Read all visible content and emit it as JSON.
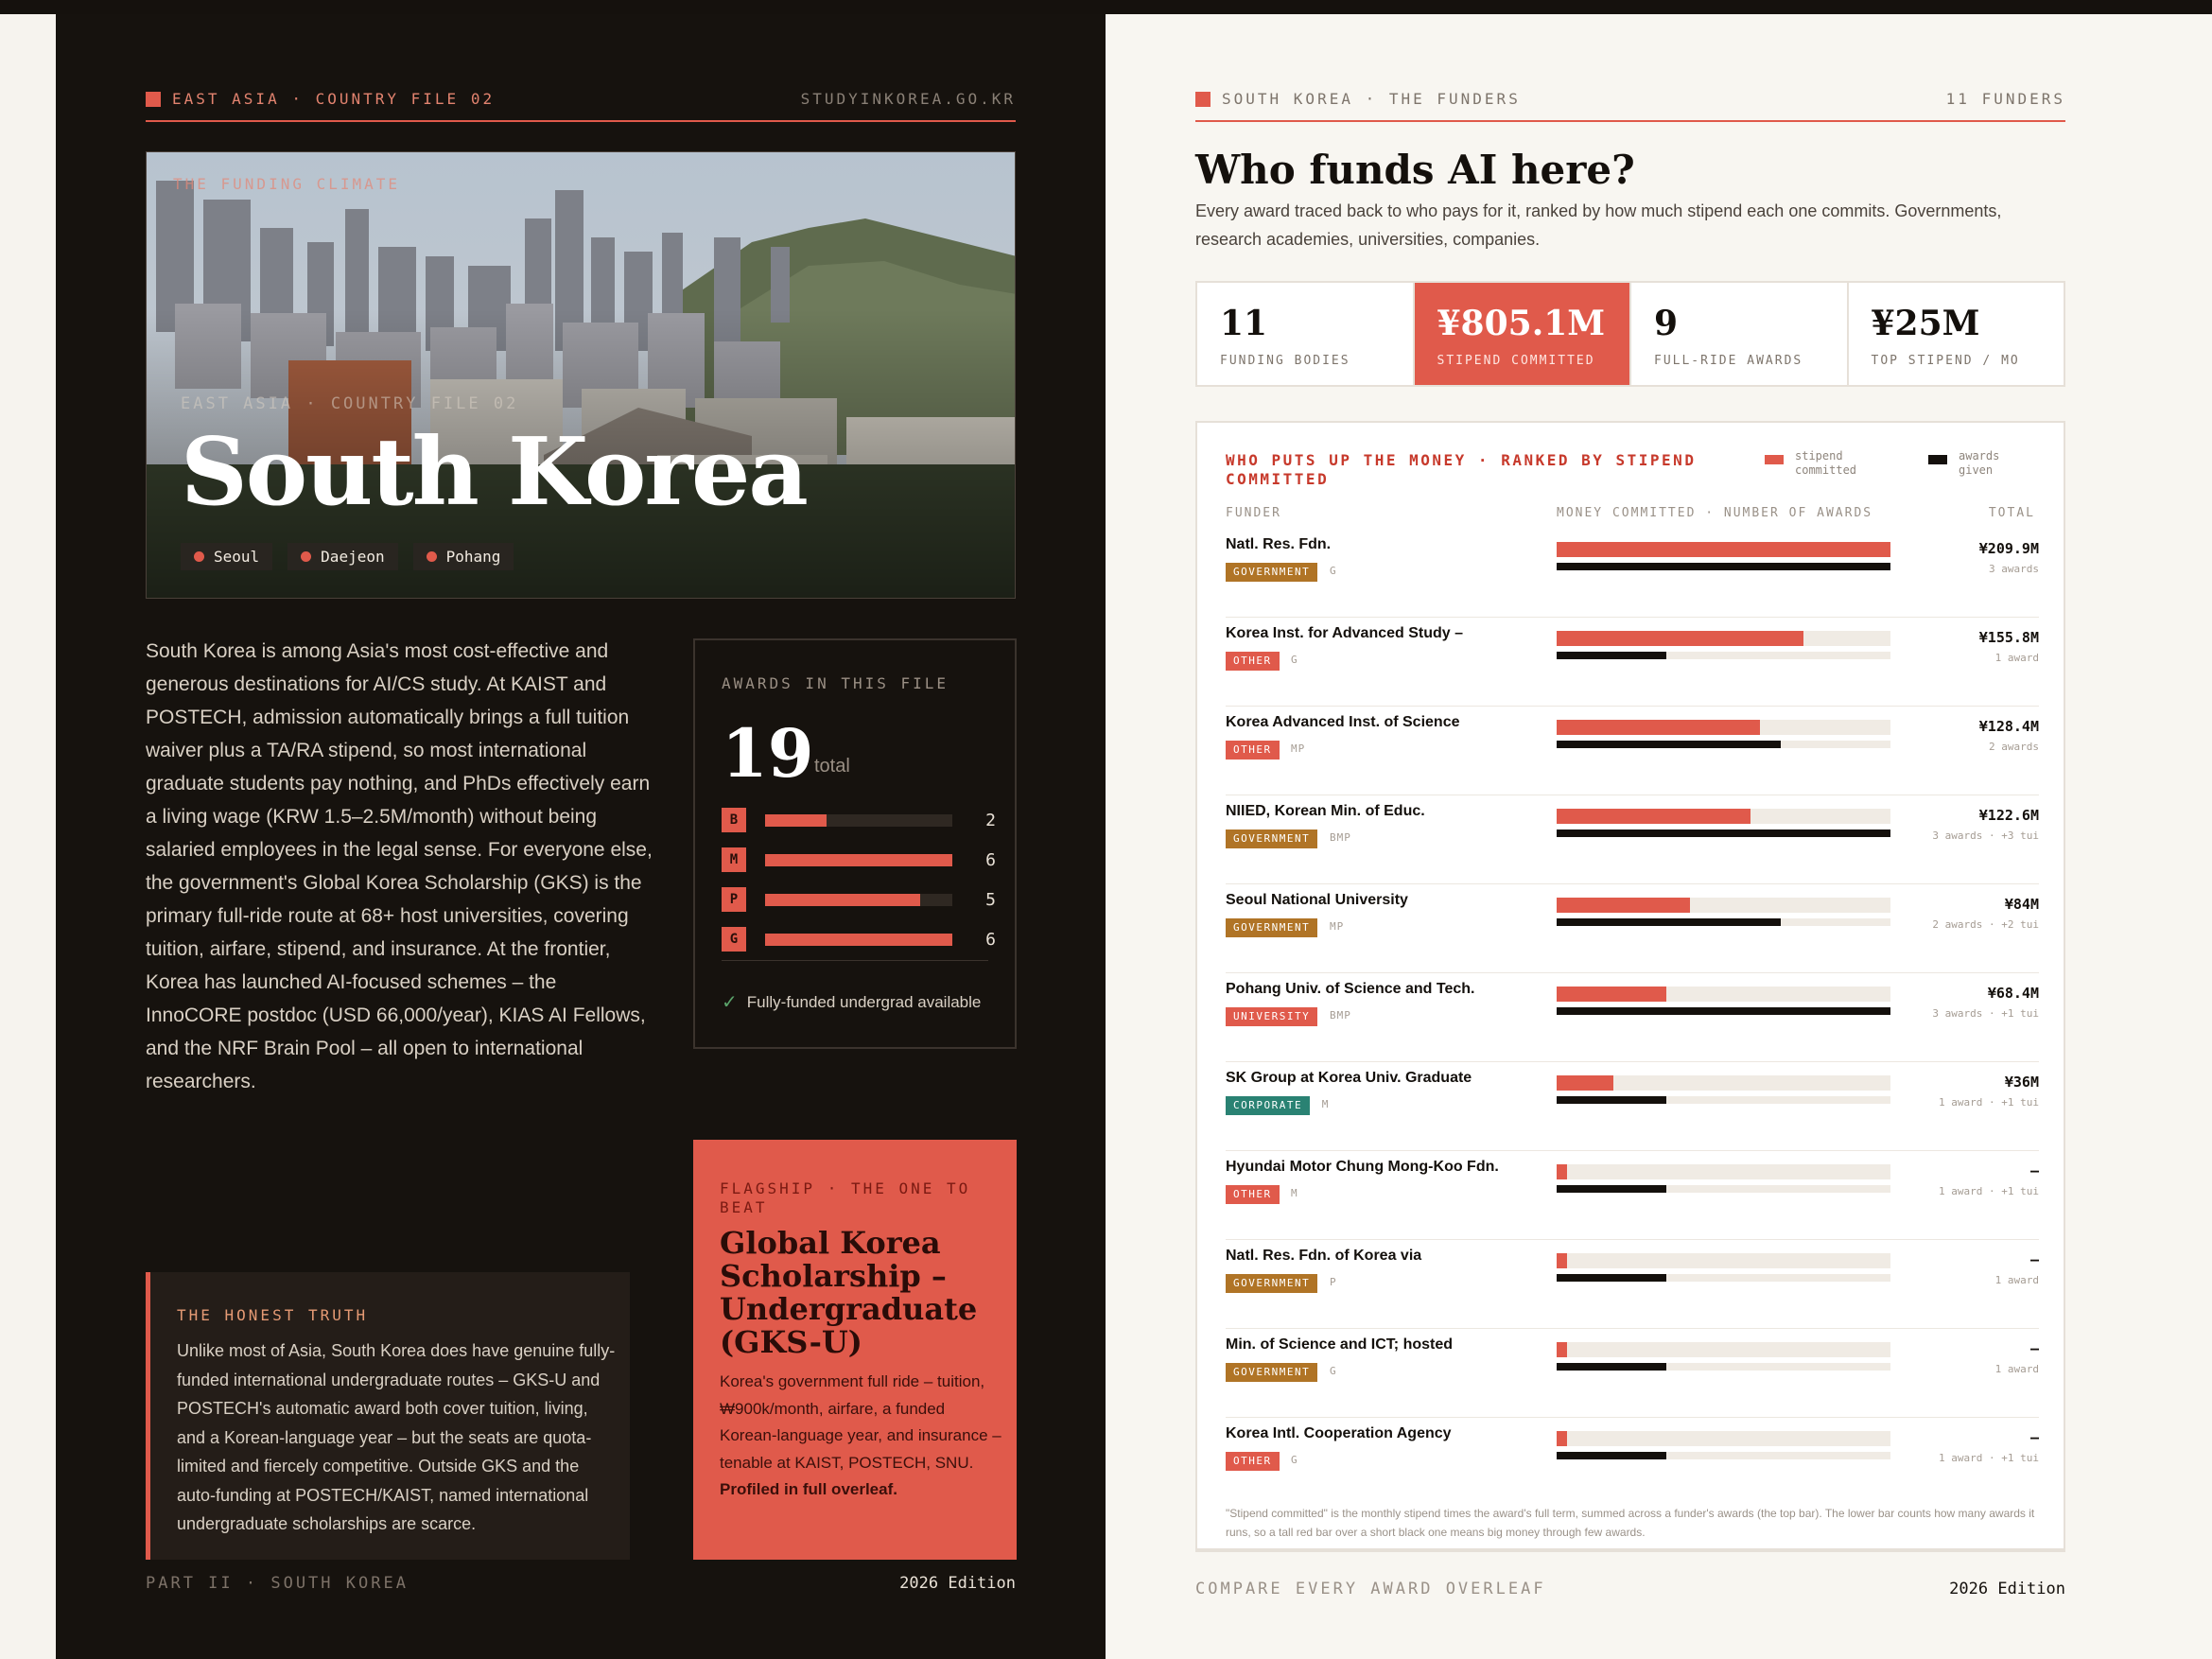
{
  "left": {
    "header": {
      "section": "EAST ASIA · COUNTRY FILE 02",
      "site": "STUDYINKOREA.GO.KR"
    },
    "hero": {
      "kicker": "THE FUNDING CLIMATE",
      "sub": "EAST ASIA · COUNTRY FILE 02",
      "title": "South Korea",
      "cities": [
        "Seoul",
        "Daejeon",
        "Pohang"
      ]
    },
    "intro": "South Korea is among Asia's most cost-effective and generous destinations for AI/CS study. At KAIST and POSTECH, admission automatically brings a full tuition waiver plus a TA/RA stipend, so most international graduate students pay nothing, and PhDs effectively earn a living wage (KRW 1.5–2.5M/month) without being salaried employees in the legal sense. For everyone else, the government's Global Korea Scholarship (GKS) is the primary full-ride route at 68+ host universities, covering tuition, airfare, stipend, and insurance. At the frontier, Korea has launched AI-focused schemes – the InnoCORE postdoc (USD 66,000/year), KIAS AI Fellows, and the NRF Brain Pool – all open to international researchers.",
    "awards": {
      "label": "AWARDS IN THIS FILE",
      "total": "19",
      "total_label": "total",
      "levels": [
        {
          "code": "B",
          "count": 2
        },
        {
          "code": "M",
          "count": 6
        },
        {
          "code": "P",
          "count": 5
        },
        {
          "code": "G",
          "count": 6
        }
      ],
      "level_fill_fractions": [
        0.33,
        1.0,
        0.83,
        1.0
      ],
      "footnote": "Fully-funded undergrad available"
    },
    "truth": {
      "kicker": "THE HONEST TRUTH",
      "text": "Unlike most of Asia, South Korea does have genuine fully-funded international undergraduate routes – GKS-U and POSTECH's automatic award both cover tuition, living, and a Korean-language year – but the seats are quota-limited and fiercely competitive. Outside GKS and the auto-funding at POSTECH/KAIST, named international undergraduate scholarships are scarce."
    },
    "flagship": {
      "kicker": "FLAGSHIP · THE ONE TO BEAT",
      "title": "Global Korea Scholarship – Undergraduate (GKS-U)",
      "text": "Korea's government full ride – tuition, ₩900k/month, airfare, a funded Korean-language year, and insurance – tenable at KAIST, POSTECH, SNU.",
      "bold": "Profiled in full overleaf."
    },
    "footer": {
      "part": "PART II · SOUTH KOREA",
      "edition": "2026 Edition"
    }
  },
  "right": {
    "header": {
      "section": "SOUTH KOREA · THE FUNDERS",
      "count": "11 FUNDERS"
    },
    "title": "Who funds AI here?",
    "subtitle": "Every award traced back to who pays for it, ranked by how much stipend each one commits. Governments, research academies, universities, companies.",
    "stats": [
      {
        "num": "11",
        "label": "FUNDING BODIES"
      },
      {
        "num": "¥805.1M",
        "label": "STIPEND COMMITTED"
      },
      {
        "num": "9",
        "label": "FULL-RIDE AWARDS"
      },
      {
        "num": "¥25M",
        "label": "TOP STIPEND / MO"
      }
    ],
    "panel": {
      "kicker": "WHO PUTS UP THE MONEY · RANKED BY STIPEND COMMITTED",
      "legend": {
        "stipend": "stipend committed",
        "awards": "awards given"
      },
      "col_funder": "FUNDER",
      "col_bars": "MONEY COMMITTED · NUMBER OF AWARDS",
      "col_total": "TOTAL",
      "note": "\"Stipend committed\" is the monthly stipend times the award's full term, summed across a funder's awards (the top bar). The lower bar counts how many awards it runs, so a tall red bar over a short black one means big money through few awards."
    },
    "colors": {
      "accent": "#e05a4b",
      "government": "#b07426",
      "other": "#e05a4b",
      "university": "#e05a4b",
      "corporate": "#2a8273"
    },
    "funders": [
      {
        "name": "Natl. Res. Fdn.",
        "cat": "GOVERNMENT",
        "levels": "G",
        "total": "¥209.9M",
        "awards": "3 awards",
        "stipend_frac": 1.0,
        "award_frac": 1.0
      },
      {
        "name": "Korea Inst. for Advanced Study –",
        "cat": "OTHER",
        "levels": "G",
        "total": "¥155.8M",
        "awards": "1 award",
        "stipend_frac": 0.74,
        "award_frac": 0.33
      },
      {
        "name": "Korea Advanced Inst. of Science",
        "cat": "OTHER",
        "levels": "MP",
        "total": "¥128.4M",
        "awards": "2 awards",
        "stipend_frac": 0.61,
        "award_frac": 0.67
      },
      {
        "name": "NIIED, Korean Min. of Educ.",
        "cat": "GOVERNMENT",
        "levels": "BMP",
        "total": "¥122.6M",
        "awards": "3 awards · +3 tui",
        "stipend_frac": 0.58,
        "award_frac": 1.0
      },
      {
        "name": "Seoul National University",
        "cat": "GOVERNMENT",
        "levels": "MP",
        "total": "¥84M",
        "awards": "2 awards · +2 tui",
        "stipend_frac": 0.4,
        "award_frac": 0.67
      },
      {
        "name": "Pohang Univ. of Science and Tech.",
        "cat": "UNIVERSITY",
        "levels": "BMP",
        "total": "¥68.4M",
        "awards": "3 awards · +1 tui",
        "stipend_frac": 0.33,
        "award_frac": 1.0
      },
      {
        "name": "SK Group at Korea Univ. Graduate",
        "cat": "CORPORATE",
        "levels": "M",
        "total": "¥36M",
        "awards": "1 award · +1 tui",
        "stipend_frac": 0.17,
        "award_frac": 0.33
      },
      {
        "name": "Hyundai Motor Chung Mong-Koo Fdn.",
        "cat": "OTHER",
        "levels": "M",
        "total": "–",
        "awards": "1 award · +1 tui",
        "stipend_frac": 0.03,
        "award_frac": 0.33
      },
      {
        "name": "Natl. Res. Fdn. of Korea via",
        "cat": "GOVERNMENT",
        "levels": "P",
        "total": "–",
        "awards": "1 award",
        "stipend_frac": 0.03,
        "award_frac": 0.33
      },
      {
        "name": "Min. of Science and ICT; hosted",
        "cat": "GOVERNMENT",
        "levels": "G",
        "total": "–",
        "awards": "1 award",
        "stipend_frac": 0.03,
        "award_frac": 0.33
      },
      {
        "name": "Korea Intl. Cooperation Agency",
        "cat": "OTHER",
        "levels": "G",
        "total": "–",
        "awards": "1 award · +1 tui",
        "stipend_frac": 0.03,
        "award_frac": 0.33
      }
    ],
    "footer": {
      "compare": "COMPARE EVERY AWARD OVERLEAF",
      "edition": "2026 Edition"
    }
  }
}
